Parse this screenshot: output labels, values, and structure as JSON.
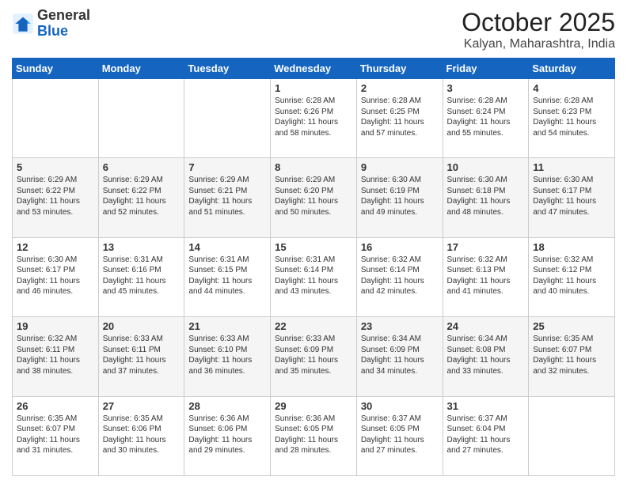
{
  "header": {
    "logo_general": "General",
    "logo_blue": "Blue",
    "month": "October 2025",
    "location": "Kalyan, Maharashtra, India"
  },
  "days_of_week": [
    "Sunday",
    "Monday",
    "Tuesday",
    "Wednesday",
    "Thursday",
    "Friday",
    "Saturday"
  ],
  "weeks": [
    [
      {
        "day": "",
        "info": ""
      },
      {
        "day": "",
        "info": ""
      },
      {
        "day": "",
        "info": ""
      },
      {
        "day": "1",
        "info": "Sunrise: 6:28 AM\nSunset: 6:26 PM\nDaylight: 11 hours\nand 58 minutes."
      },
      {
        "day": "2",
        "info": "Sunrise: 6:28 AM\nSunset: 6:25 PM\nDaylight: 11 hours\nand 57 minutes."
      },
      {
        "day": "3",
        "info": "Sunrise: 6:28 AM\nSunset: 6:24 PM\nDaylight: 11 hours\nand 55 minutes."
      },
      {
        "day": "4",
        "info": "Sunrise: 6:28 AM\nSunset: 6:23 PM\nDaylight: 11 hours\nand 54 minutes."
      }
    ],
    [
      {
        "day": "5",
        "info": "Sunrise: 6:29 AM\nSunset: 6:22 PM\nDaylight: 11 hours\nand 53 minutes."
      },
      {
        "day": "6",
        "info": "Sunrise: 6:29 AM\nSunset: 6:22 PM\nDaylight: 11 hours\nand 52 minutes."
      },
      {
        "day": "7",
        "info": "Sunrise: 6:29 AM\nSunset: 6:21 PM\nDaylight: 11 hours\nand 51 minutes."
      },
      {
        "day": "8",
        "info": "Sunrise: 6:29 AM\nSunset: 6:20 PM\nDaylight: 11 hours\nand 50 minutes."
      },
      {
        "day": "9",
        "info": "Sunrise: 6:30 AM\nSunset: 6:19 PM\nDaylight: 11 hours\nand 49 minutes."
      },
      {
        "day": "10",
        "info": "Sunrise: 6:30 AM\nSunset: 6:18 PM\nDaylight: 11 hours\nand 48 minutes."
      },
      {
        "day": "11",
        "info": "Sunrise: 6:30 AM\nSunset: 6:17 PM\nDaylight: 11 hours\nand 47 minutes."
      }
    ],
    [
      {
        "day": "12",
        "info": "Sunrise: 6:30 AM\nSunset: 6:17 PM\nDaylight: 11 hours\nand 46 minutes."
      },
      {
        "day": "13",
        "info": "Sunrise: 6:31 AM\nSunset: 6:16 PM\nDaylight: 11 hours\nand 45 minutes."
      },
      {
        "day": "14",
        "info": "Sunrise: 6:31 AM\nSunset: 6:15 PM\nDaylight: 11 hours\nand 44 minutes."
      },
      {
        "day": "15",
        "info": "Sunrise: 6:31 AM\nSunset: 6:14 PM\nDaylight: 11 hours\nand 43 minutes."
      },
      {
        "day": "16",
        "info": "Sunrise: 6:32 AM\nSunset: 6:14 PM\nDaylight: 11 hours\nand 42 minutes."
      },
      {
        "day": "17",
        "info": "Sunrise: 6:32 AM\nSunset: 6:13 PM\nDaylight: 11 hours\nand 41 minutes."
      },
      {
        "day": "18",
        "info": "Sunrise: 6:32 AM\nSunset: 6:12 PM\nDaylight: 11 hours\nand 40 minutes."
      }
    ],
    [
      {
        "day": "19",
        "info": "Sunrise: 6:32 AM\nSunset: 6:11 PM\nDaylight: 11 hours\nand 38 minutes."
      },
      {
        "day": "20",
        "info": "Sunrise: 6:33 AM\nSunset: 6:11 PM\nDaylight: 11 hours\nand 37 minutes."
      },
      {
        "day": "21",
        "info": "Sunrise: 6:33 AM\nSunset: 6:10 PM\nDaylight: 11 hours\nand 36 minutes."
      },
      {
        "day": "22",
        "info": "Sunrise: 6:33 AM\nSunset: 6:09 PM\nDaylight: 11 hours\nand 35 minutes."
      },
      {
        "day": "23",
        "info": "Sunrise: 6:34 AM\nSunset: 6:09 PM\nDaylight: 11 hours\nand 34 minutes."
      },
      {
        "day": "24",
        "info": "Sunrise: 6:34 AM\nSunset: 6:08 PM\nDaylight: 11 hours\nand 33 minutes."
      },
      {
        "day": "25",
        "info": "Sunrise: 6:35 AM\nSunset: 6:07 PM\nDaylight: 11 hours\nand 32 minutes."
      }
    ],
    [
      {
        "day": "26",
        "info": "Sunrise: 6:35 AM\nSunset: 6:07 PM\nDaylight: 11 hours\nand 31 minutes."
      },
      {
        "day": "27",
        "info": "Sunrise: 6:35 AM\nSunset: 6:06 PM\nDaylight: 11 hours\nand 30 minutes."
      },
      {
        "day": "28",
        "info": "Sunrise: 6:36 AM\nSunset: 6:06 PM\nDaylight: 11 hours\nand 29 minutes."
      },
      {
        "day": "29",
        "info": "Sunrise: 6:36 AM\nSunset: 6:05 PM\nDaylight: 11 hours\nand 28 minutes."
      },
      {
        "day": "30",
        "info": "Sunrise: 6:37 AM\nSunset: 6:05 PM\nDaylight: 11 hours\nand 27 minutes."
      },
      {
        "day": "31",
        "info": "Sunrise: 6:37 AM\nSunset: 6:04 PM\nDaylight: 11 hours\nand 27 minutes."
      },
      {
        "day": "",
        "info": ""
      }
    ]
  ]
}
